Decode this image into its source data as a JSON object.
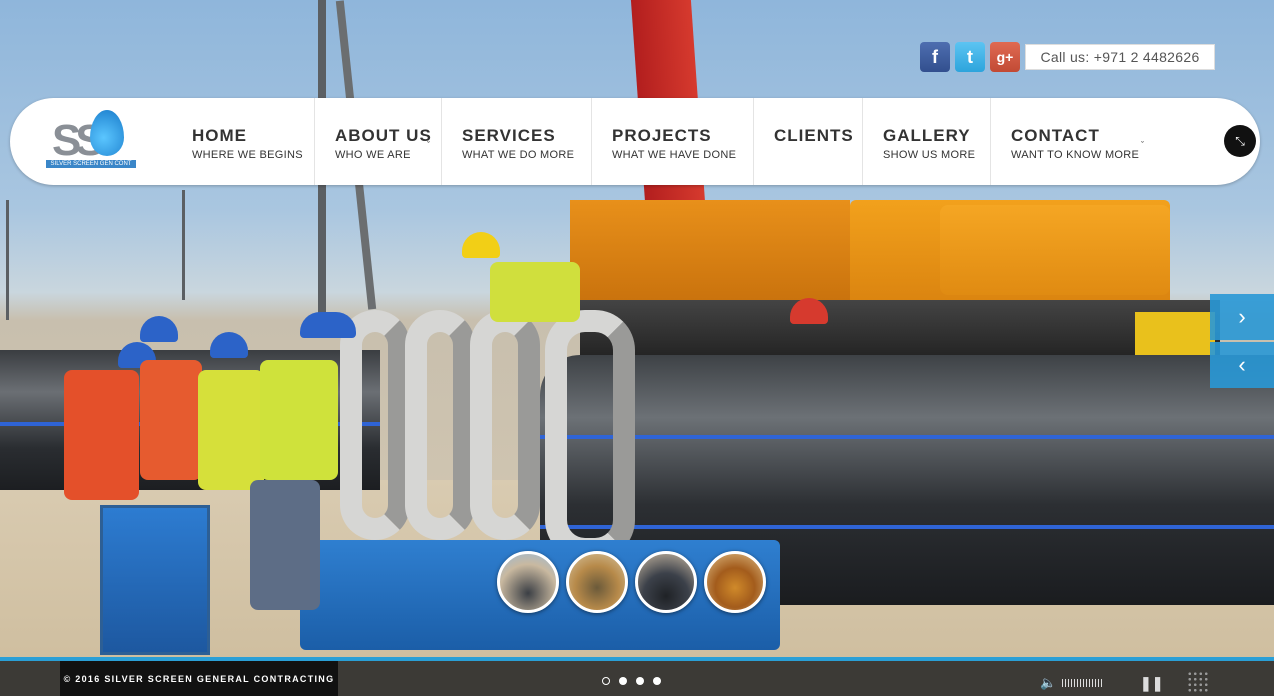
{
  "social": {
    "facebook_icon": "f",
    "twitter_icon": "t",
    "googleplus_icon": "g+"
  },
  "contact_bar": {
    "call_text": "Call us: +971 2 4482626"
  },
  "logo": {
    "text": "SILVER SCREEN GEN CONT"
  },
  "nav": {
    "items": [
      {
        "title": "HOME",
        "subtitle": "WHERE WE BEGINS"
      },
      {
        "title": "ABOUT US",
        "subtitle": "WHO WE ARE"
      },
      {
        "title": "SERVICES",
        "subtitle": "WHAT WE DO MORE"
      },
      {
        "title": "PROJECTS",
        "subtitle": "WHAT WE HAVE DONE"
      },
      {
        "title": "CLIENTS",
        "subtitle": ""
      },
      {
        "title": "GALLERY",
        "subtitle": "SHOW US MORE"
      },
      {
        "title": "CONTACT",
        "subtitle": "WANT TO KNOW MORE"
      }
    ]
  },
  "slider": {
    "next_icon": "›",
    "prev_icon": "‹",
    "active_slide": 1,
    "slide_count": 4,
    "thumbnails": [
      "thumb-1",
      "thumb-2",
      "thumb-3",
      "thumb-4"
    ]
  },
  "footer": {
    "copyright": "© 2016 SILVER SCREEN GENERAL CONTRACTING",
    "volume_icon": "🔈",
    "pause_icon": "❚❚"
  },
  "colors": {
    "accent": "#2a9fd6",
    "nav_text": "#333333",
    "facebook": "#3b5998",
    "twitter": "#3fb4e8",
    "googleplus": "#d34f3a"
  }
}
